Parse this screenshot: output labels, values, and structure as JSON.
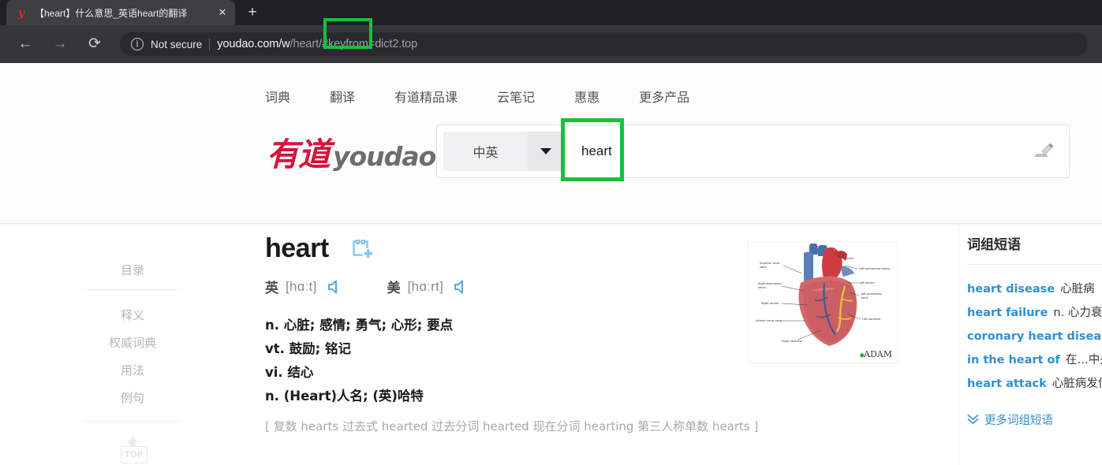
{
  "browser": {
    "tab": {
      "favicon": "youdao-y-icon",
      "title": "【heart】什么意思_英语heart的翻译",
      "close_label": "✕"
    },
    "new_tab_label": "+",
    "nav": {
      "back_label": "←",
      "forward_label": "→",
      "reload_label": "⟳"
    },
    "omnibox": {
      "info_icon_label": "i",
      "security_label": "Not secure",
      "url_prefix": "youdao.com/w",
      "url_highlighted": "/heart/",
      "url_suffix": "#keyfrom=dict2.top"
    }
  },
  "site": {
    "nav_items": [
      {
        "label": "词典"
      },
      {
        "label": "翻译"
      },
      {
        "label": "有道精品课"
      },
      {
        "label": "云笔记"
      },
      {
        "label": "惠惠"
      },
      {
        "label": "更多产品"
      }
    ],
    "logo": {
      "cn": "有道",
      "en": "youdao"
    },
    "search": {
      "language_label": "中英",
      "query_value": "heart",
      "query_placeholder": "",
      "handwrite_icon": "handwriting-input-icon",
      "submit_label": ""
    }
  },
  "left_rail": {
    "heading": "目录",
    "items": [
      {
        "label": "释义"
      },
      {
        "label": "权威词典"
      },
      {
        "label": "用法"
      },
      {
        "label": "例句"
      }
    ],
    "top_button_label": "TOP"
  },
  "entry": {
    "word": "heart",
    "add_icon": "add-to-wordbook-icon",
    "phonetics": [
      {
        "region": "英",
        "value": "[hɑːt]",
        "speaker_icon": "speaker-icon"
      },
      {
        "region": "美",
        "value": "[hɑːrt]",
        "speaker_icon": "speaker-icon"
      }
    ],
    "definitions": [
      "n. 心脏; 感情; 勇气; 心形; 要点",
      "vt. 鼓励; 铭记",
      "vi. 结心",
      "n. (Heart)人名; (英)哈特"
    ],
    "inflections": "[ 复数 hearts 过去式 hearted 过去分词 hearted 现在分词 hearting 第三人称单数 hearts ]",
    "figure": {
      "name": "heart-anatomy-diagram",
      "watermark": "ADAM",
      "labels_left": [
        "Superior vena cava",
        "Right pulmonary veins",
        "Right atrium",
        "Inferior vena cava",
        "Right ventricle"
      ],
      "labels_right": [
        "Aorta",
        "Left pulmonary artery",
        "Left atrium",
        "Left pulmonary veins",
        "Left ventricle"
      ]
    }
  },
  "phrases_panel": {
    "heading": "词组短语",
    "items": [
      {
        "en": "heart disease",
        "cn": "心脏病"
      },
      {
        "en": "heart failure",
        "cn": "n. 心力衰竭"
      },
      {
        "en": "coronary heart disease",
        "cn": ""
      },
      {
        "en": "in the heart of",
        "cn": "在…中央"
      },
      {
        "en": "heart attack",
        "cn": "心脏病发作"
      }
    ],
    "more_label": "更多词组短语",
    "more_icon": "chevron-double-down-icon"
  },
  "colors": {
    "brand_red": "#d4143c",
    "link_blue": "#2f8fd0",
    "highlight_green": "#18c13c",
    "search_button_red": "#e1272e"
  }
}
